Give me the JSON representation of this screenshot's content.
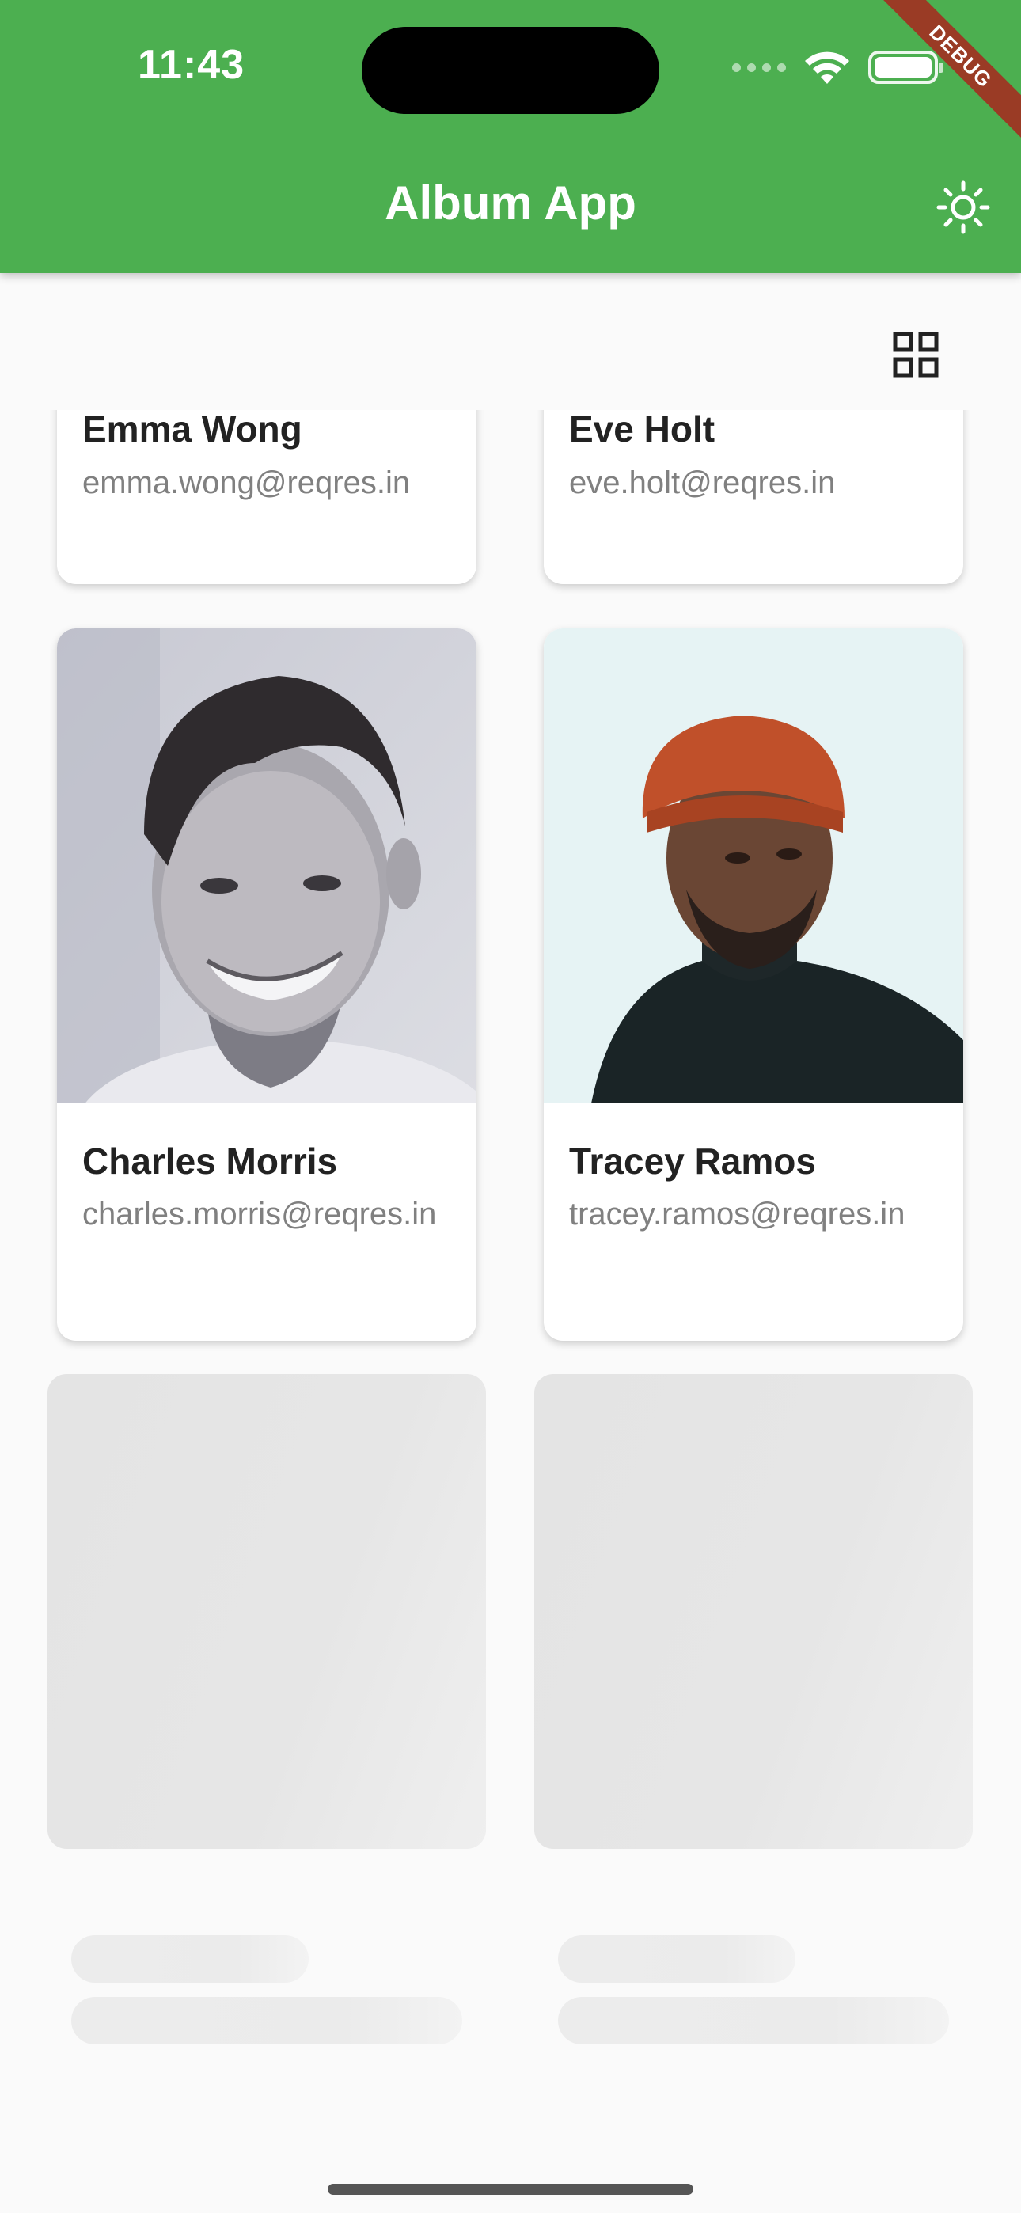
{
  "status_bar": {
    "time": "11:43"
  },
  "app_bar": {
    "title": "Album App",
    "theme_icon": "sun-icon"
  },
  "debug_banner": "DEBUG",
  "toolbar": {
    "view_toggle_icon": "grid-view-icon"
  },
  "users": [
    {
      "name": "Emma Wong",
      "email": "emma.wong@reqres.in"
    },
    {
      "name": "Eve Holt",
      "email": "eve.holt@reqres.in"
    },
    {
      "name": "Charles Morris",
      "email": "charles.morris@reqres.in"
    },
    {
      "name": "Tracey Ramos",
      "email": "tracey.ramos@reqres.in"
    }
  ],
  "colors": {
    "app_bar": "#4caf50",
    "background": "#fafafa",
    "debug_banner": "#9a3b25"
  }
}
